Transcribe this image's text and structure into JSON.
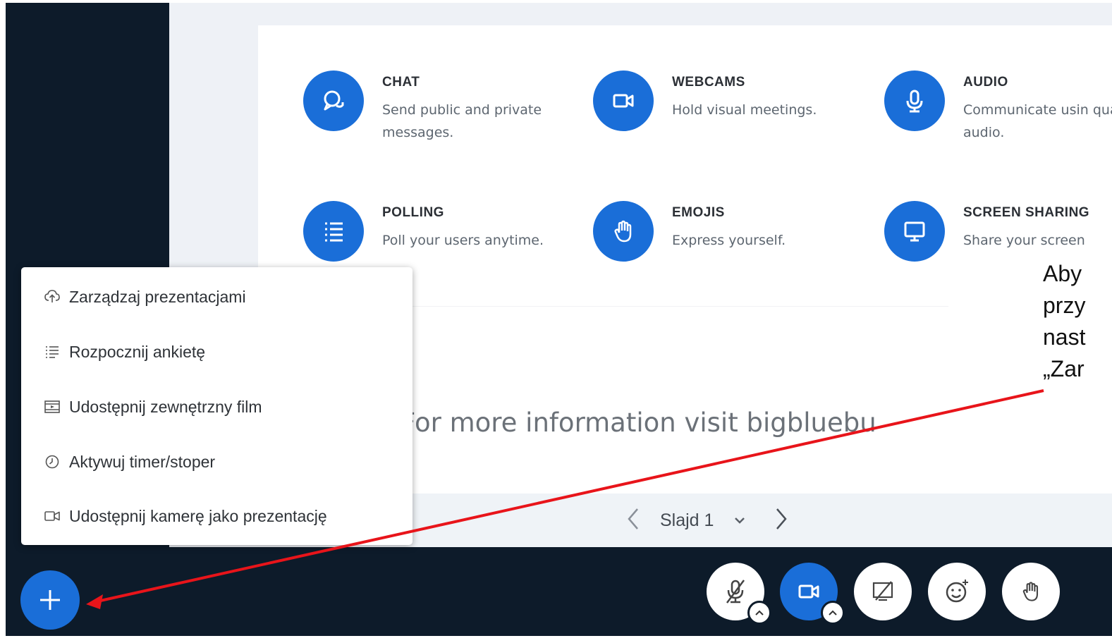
{
  "features": [
    {
      "id": "chat",
      "title": "CHAT",
      "desc": "Send public and private messages.",
      "icon": "chat-icon"
    },
    {
      "id": "webcams",
      "title": "WEBCAMS",
      "desc": "Hold visual meetings.",
      "icon": "webcam-icon"
    },
    {
      "id": "audio",
      "title": "AUDIO",
      "desc": "Communicate usin quality audio.",
      "icon": "microphone-icon"
    },
    {
      "id": "polling",
      "title": "POLLING",
      "desc": "Poll your users anytime.",
      "icon": "list-icon"
    },
    {
      "id": "emojis",
      "title": "EMOJIS",
      "desc": "Express yourself.",
      "icon": "hand-icon"
    },
    {
      "id": "screen",
      "title": "SCREEN SHARING",
      "desc": "Share your screen",
      "icon": "monitor-icon"
    }
  ],
  "more_info": "For more information visit bigbluebu",
  "slide_nav": {
    "label": "Slajd 1",
    "prev_icon": "chevron-left-icon",
    "next_icon": "chevron-right-icon",
    "dropdown_icon": "chevron-down-icon"
  },
  "menu": {
    "items": [
      {
        "label": "Zarządzaj prezentacjami",
        "icon": "cloud-upload-icon"
      },
      {
        "label": "Rozpocznij ankietę",
        "icon": "list-icon"
      },
      {
        "label": "Udostępnij zewnętrzny film",
        "icon": "film-icon"
      },
      {
        "label": "Aktywuj timer/stoper",
        "icon": "clock-icon"
      },
      {
        "label": "Udostępnij kamerę jako prezentację",
        "icon": "camera-icon"
      }
    ]
  },
  "controls": [
    {
      "name": "mute-microphone-button",
      "icon": "microphone-off-icon"
    },
    {
      "name": "webcam-button",
      "icon": "webcam-icon"
    },
    {
      "name": "screen-share-button",
      "icon": "screen-share-off-icon"
    },
    {
      "name": "reactions-button",
      "icon": "emoji-icon"
    },
    {
      "name": "raise-hand-button",
      "icon": "hand-icon"
    }
  ],
  "annotation": {
    "lines": [
      "Aby",
      "przy",
      "nast",
      "„Zar"
    ]
  },
  "colors": {
    "accent": "#1a6ed8",
    "dark_bg": "#0d1b2a",
    "arrow": "#e8141a"
  }
}
